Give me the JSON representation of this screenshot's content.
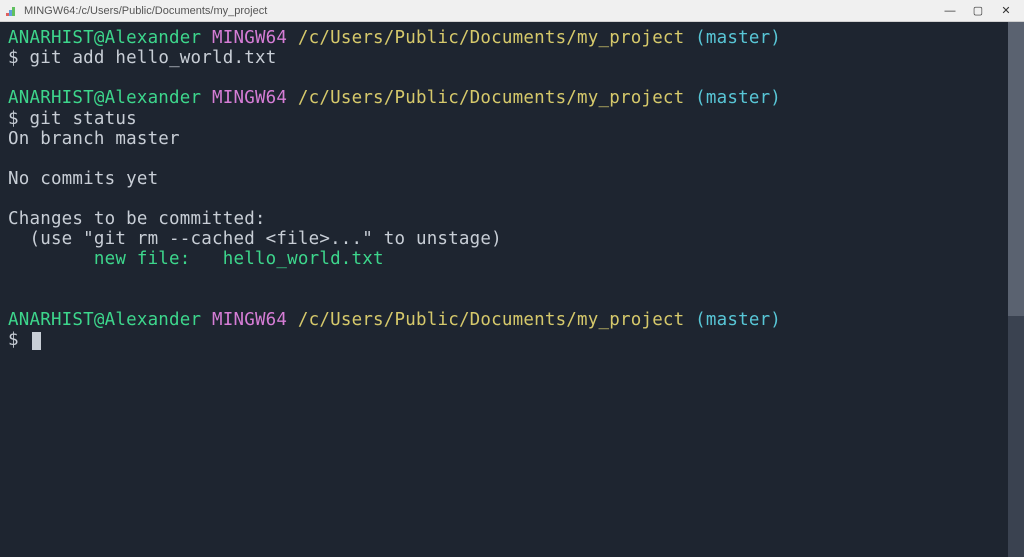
{
  "titlebar": {
    "title": "MINGW64:/c/Users/Public/Documents/my_project"
  },
  "window_controls": {
    "minimize": "—",
    "maximize": "▢",
    "close": "✕"
  },
  "prompt": {
    "user_host": "ANARHIST@Alexander",
    "mingw": "MINGW64",
    "path": "/c/Users/Public/Documents/my_project",
    "branch": "(master)",
    "symbol": "$"
  },
  "blocks": [
    {
      "command": "git add hello_world.txt",
      "output": []
    },
    {
      "command": "git status",
      "output": [
        {
          "text": "On branch master",
          "class": "out"
        },
        {
          "text": "",
          "class": "empty"
        },
        {
          "text": "No commits yet",
          "class": "out"
        },
        {
          "text": "",
          "class": "empty"
        },
        {
          "text": "Changes to be committed:",
          "class": "out"
        },
        {
          "text": "  (use \"git rm --cached <file>...\" to unstage)",
          "class": "out"
        },
        {
          "text": "        new file:   hello_world.txt",
          "class": "new-file"
        },
        {
          "text": "",
          "class": "empty"
        }
      ]
    },
    {
      "command": "",
      "cursor": true
    }
  ]
}
